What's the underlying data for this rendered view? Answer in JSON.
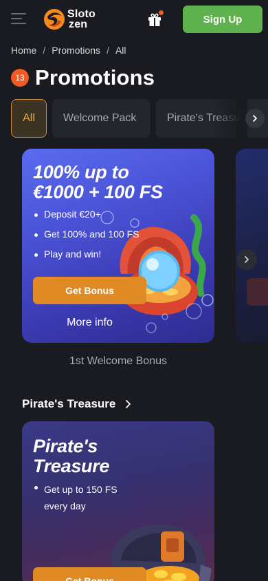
{
  "header": {
    "menu_icon": "hamburger-menu-icon",
    "logo": {
      "line1": "Sloto",
      "line2": "zen"
    },
    "gift_icon": "gift-icon",
    "signup_label": "Sign Up"
  },
  "breadcrumb": [
    "Home",
    "Promotions",
    "All"
  ],
  "page": {
    "count": "13",
    "title": "Promotions"
  },
  "tabs": [
    {
      "label": "All",
      "active": true
    },
    {
      "label": "Welcome Pack",
      "active": false
    },
    {
      "label": "Pirate's Treasure",
      "active": false
    }
  ],
  "promo_cards": [
    {
      "title_line1": "100% up to",
      "title_line2": "€1000 + 100 FS",
      "bullets": [
        "Deposit €20+",
        "Get 100% and 100 FS",
        "Play and win!"
      ],
      "button_label": "Get Bonus",
      "more_info_label": "More info",
      "caption": "1st Welcome Bonus"
    }
  ],
  "section": {
    "title": "Pirate's Treasure",
    "card": {
      "title_line1": "Pirate's",
      "title_line2": "Treasure",
      "bullet_line1": "Get up to 150 FS",
      "bullet_line2": "every day",
      "button_label": "Get Bonus"
    }
  },
  "colors": {
    "background": "#191b20",
    "signup": "#5fb24e",
    "accent_orange": "#e08a25",
    "badge": "#f05a24"
  }
}
